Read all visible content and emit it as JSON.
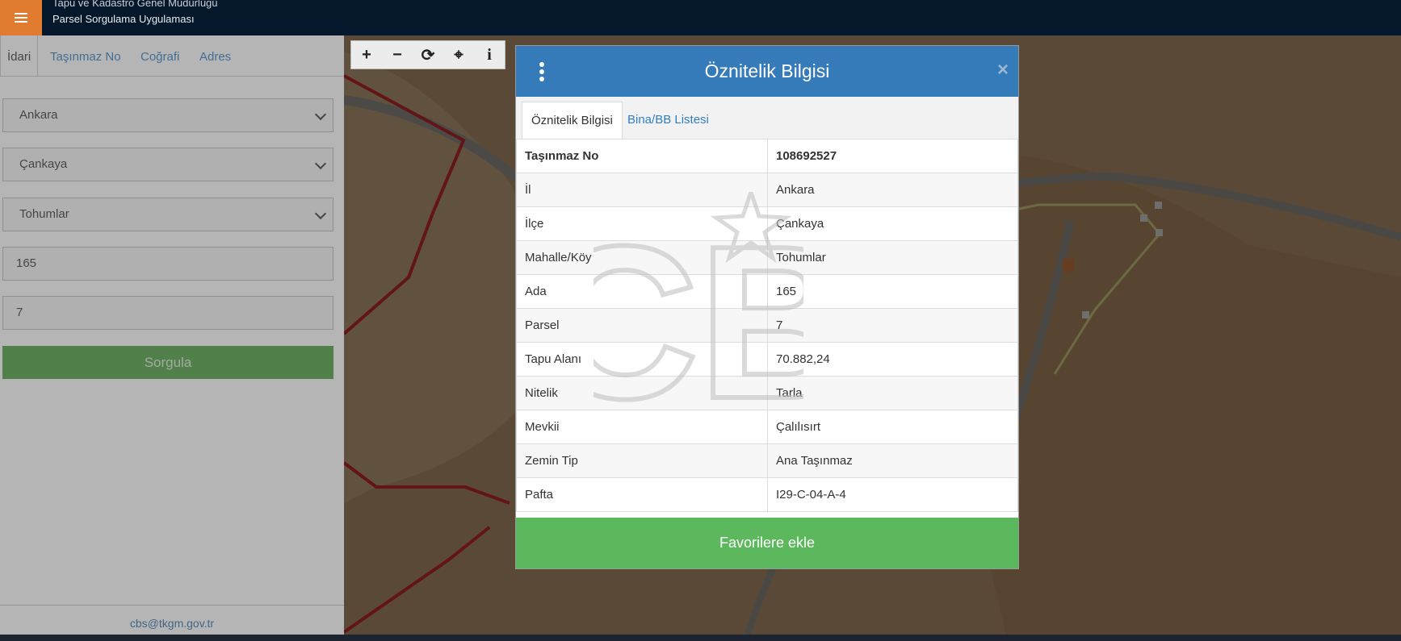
{
  "header": {
    "org_name": "Tapu ve Kadastro Genel Müdürlüğü",
    "app_name": "Parsel Sorgulama Uygulaması"
  },
  "left_panel": {
    "tabs": [
      {
        "label": "İdari"
      },
      {
        "label": "Taşınmaz No"
      },
      {
        "label": "Coğrafi"
      },
      {
        "label": "Adres"
      }
    ],
    "il_select": "Ankara",
    "ilce_select": "Çankaya",
    "mahalle_select": "Tohumlar",
    "ada_input": "165",
    "parsel_input": "7",
    "query_button": "Sorgula",
    "footer_email": "cbs@tkgm.gov.tr"
  },
  "map_toolbar": {
    "zoom_in": "+",
    "zoom_out": "−",
    "refresh": "⟳",
    "locate": "⌖",
    "info": "i"
  },
  "modal": {
    "title": "Öznitelik Bilgisi",
    "close": "×",
    "tabs": [
      {
        "label": "Öznitelik Bilgisi"
      },
      {
        "label": "Bina/BB Listesi"
      }
    ],
    "rows": [
      {
        "label": "Taşınmaz No",
        "value": "108692527"
      },
      {
        "label": "İl",
        "value": "Ankara"
      },
      {
        "label": "İlçe",
        "value": "Çankaya"
      },
      {
        "label": "Mahalle/Köy",
        "value": "Tohumlar"
      },
      {
        "label": "Ada",
        "value": "165"
      },
      {
        "label": "Parsel",
        "value": "7"
      },
      {
        "label": "Tapu Alanı",
        "value": "70.882,24"
      },
      {
        "label": "Nitelik",
        "value": "Tarla"
      },
      {
        "label": "Mevkii",
        "value": "Çalılısırt"
      },
      {
        "label": "Zemin Tip",
        "value": "Ana Taşınmaz"
      },
      {
        "label": "Pafta",
        "value": "I29-C-04-A-4"
      }
    ],
    "favorite_button": "Favorilere ekle"
  },
  "colors": {
    "header_bg": "#05172a",
    "menu_accent": "#e07b2f",
    "modal_header": "#357ab9",
    "primary_green": "#5cb85c",
    "query_green": "#4a9e3f",
    "parcel_border": "#c0141c"
  },
  "watermark_text": "CB"
}
